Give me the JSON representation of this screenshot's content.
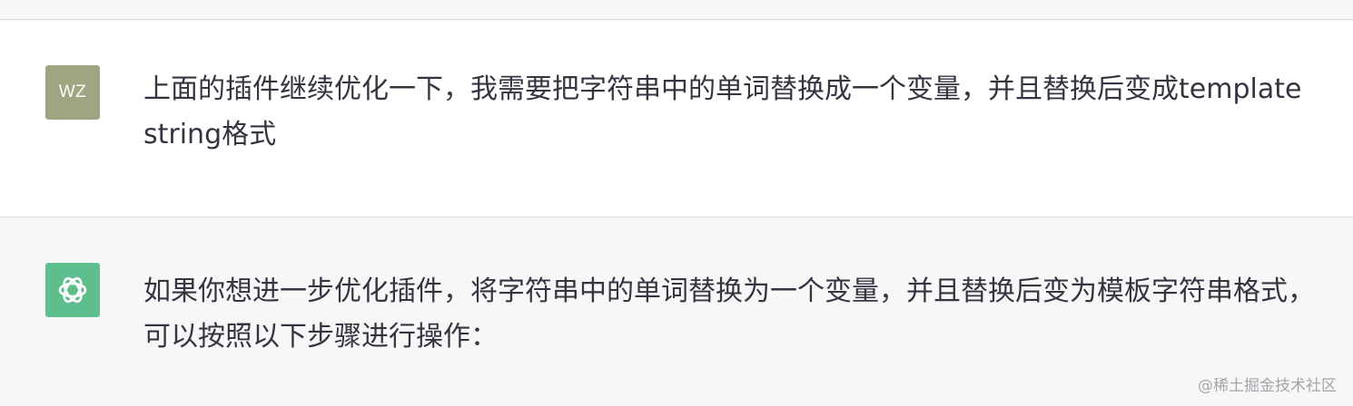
{
  "conversation": {
    "user_turn": {
      "avatar_text": "WZ",
      "avatar_color": "#a0a481",
      "message": "上面的插件继续优化一下，我需要把字符串中的单词替换成一个变量，并且替换后变成template string格式"
    },
    "assistant_turn": {
      "avatar_icon": "openai-logo-icon",
      "avatar_color": "#5fbe8e",
      "message": "如果你想进一步优化插件，将字符串中的单词替换为一个变量，并且替换后变为模板字符串格式，可以按照以下步骤进行操作："
    }
  },
  "watermark": "@稀土掘金技术社区"
}
